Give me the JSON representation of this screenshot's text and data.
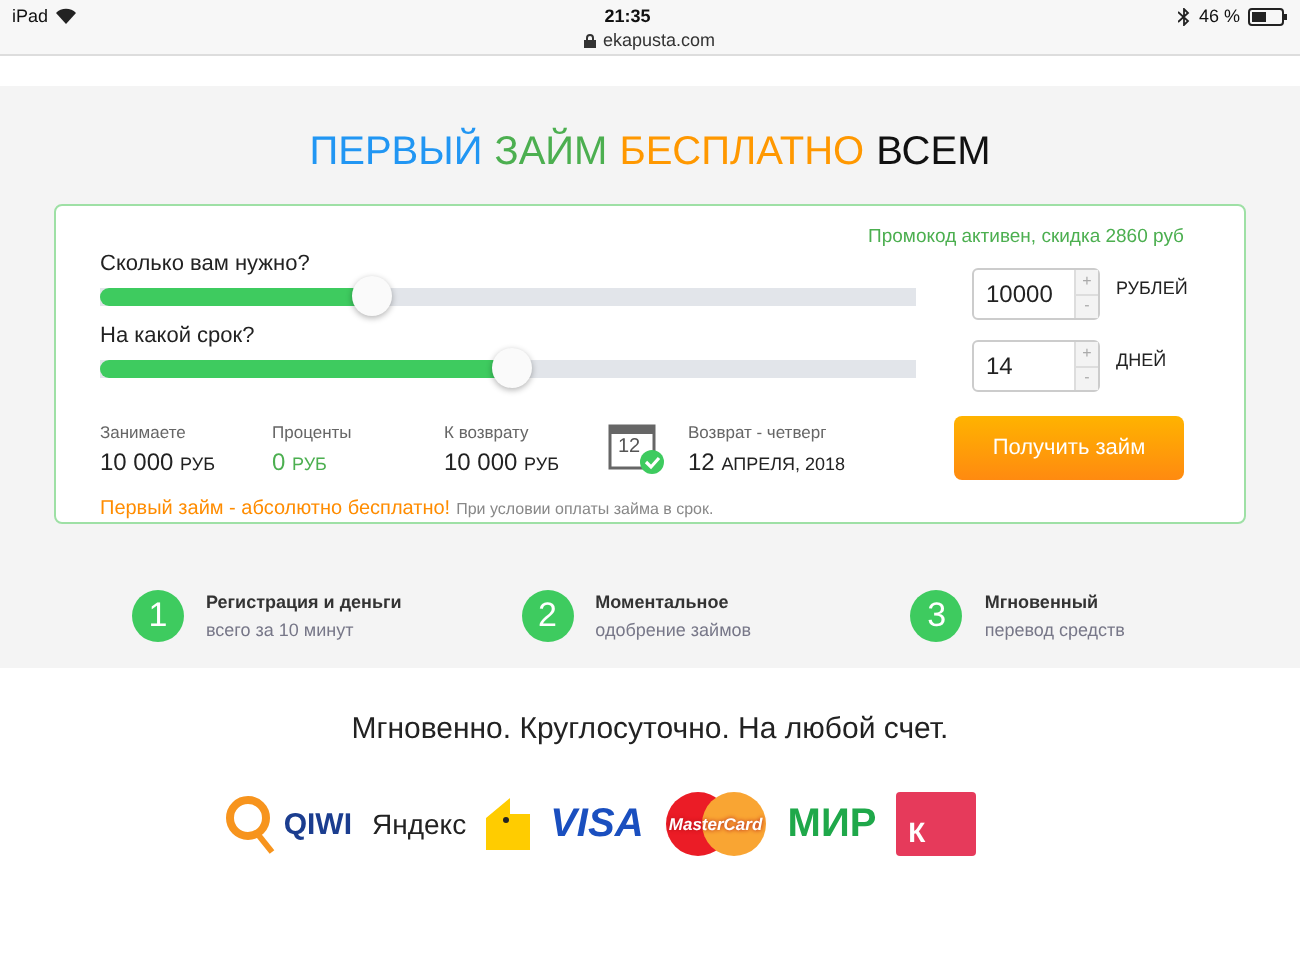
{
  "status_bar": {
    "device": "iPad",
    "time": "21:35",
    "url": "ekapusta.com",
    "battery": "46 %"
  },
  "headline": [
    {
      "text": "ПЕРВЫЙ",
      "color": "#2196f3"
    },
    {
      "text": "ЗАЙМ",
      "color": "#4caf50"
    },
    {
      "text": "БЕСПЛАТНО",
      "color": "#ff9800"
    },
    {
      "text": "ВСЕМ",
      "color": "#111111"
    }
  ],
  "calculator": {
    "promo": "Промокод активен, скидка 2860 руб",
    "sliders": [
      {
        "label": "Сколько вам нужно?",
        "level": 0.334,
        "value": "10000",
        "unit": "РУБЛЕЙ",
        "plus": "+",
        "minus": "-"
      },
      {
        "label": "На какой срок?",
        "level": 0.504,
        "value": "14",
        "unit": "ДНЕЙ",
        "plus": "+",
        "minus": "-"
      }
    ],
    "summary": [
      {
        "label": "Занимаете",
        "amount": "10 000",
        "currency": "РУБ",
        "highlight": false
      },
      {
        "label": "Проценты",
        "amount": "0",
        "currency": "РУБ",
        "highlight": true
      },
      {
        "label": "К возврату",
        "amount": "10 000",
        "currency": "РУБ",
        "highlight": false
      }
    ],
    "return": {
      "label": "Возврат - четверг",
      "day": "12",
      "date": "АПРЕЛЯ, 2018",
      "calendar_day": "12"
    },
    "button": "Получить займ",
    "note": "Первый займ - абсолютно бесплатно!",
    "note_small": "При условии оплаты займа в срок."
  },
  "steps": [
    {
      "number": "1",
      "title": "Регистрация и деньги",
      "subtitle": "всего за 10 минут"
    },
    {
      "number": "2",
      "title": "Моментальное",
      "subtitle": "одобрение займов"
    },
    {
      "number": "3",
      "title": "Мгновенный",
      "subtitle": "перевод средств"
    }
  ],
  "payments": {
    "title": "Мгновенно. Круглосуточно. На любой счет.",
    "logos": [
      {
        "kind": "qiwi",
        "text": "QIWI"
      },
      {
        "kind": "yandex",
        "text": "Яндекс"
      },
      {
        "kind": "wallet"
      },
      {
        "kind": "visa",
        "text": "VISA"
      },
      {
        "kind": "mastercard",
        "text": "MasterCard"
      },
      {
        "kind": "mir",
        "text": "МИР"
      },
      {
        "kind": "kassa",
        "text": "К"
      }
    ]
  }
}
